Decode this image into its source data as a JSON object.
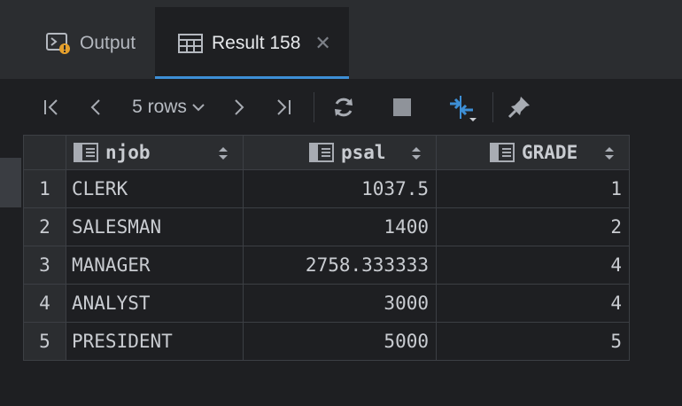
{
  "tabs": {
    "output_label": "Output",
    "result_label": "Result 158",
    "close_glyph": "✕"
  },
  "toolbar": {
    "rows_label": "5 rows",
    "icons": [
      "first-page-icon",
      "prev-page-icon",
      "rows-dropdown",
      "next-page-icon",
      "last-page-icon",
      "refresh-icon",
      "stop-icon",
      "compare-icon",
      "pin-icon"
    ]
  },
  "grid": {
    "columns": [
      "njob",
      "psal",
      "GRADE"
    ],
    "rows": [
      {
        "n": "1",
        "njob": "CLERK",
        "psal": "1037.5",
        "grade": "1"
      },
      {
        "n": "2",
        "njob": "SALESMAN",
        "psal": "1400",
        "grade": "2"
      },
      {
        "n": "3",
        "njob": "MANAGER",
        "psal": "2758.333333",
        "grade": "4"
      },
      {
        "n": "4",
        "njob": "ANALYST",
        "psal": "3000",
        "grade": "4"
      },
      {
        "n": "5",
        "njob": "PRESIDENT",
        "psal": "5000",
        "grade": "5"
      }
    ]
  },
  "colors": {
    "accent": "#3d8fd6",
    "background": "#1e1f22",
    "panel": "#2b2d30"
  }
}
